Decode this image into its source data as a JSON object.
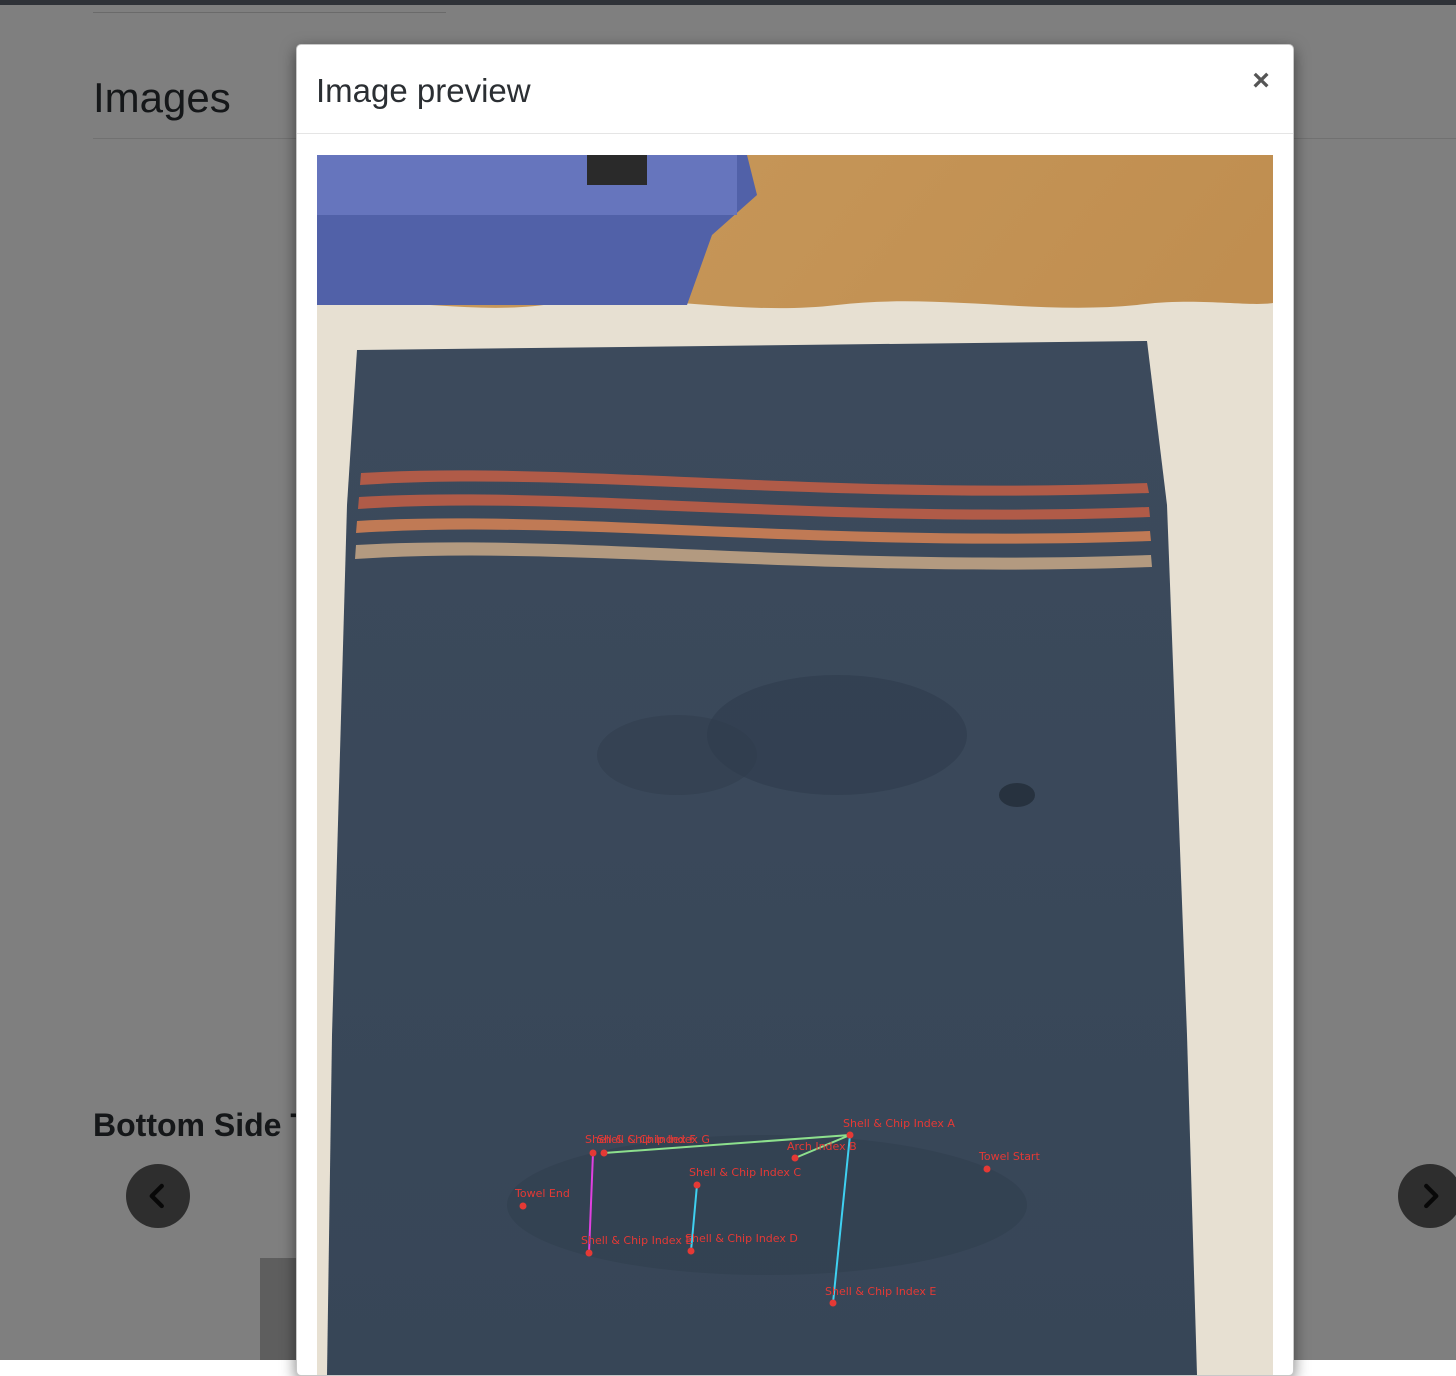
{
  "page": {
    "heading": "Images",
    "section_title": "Bottom Side T"
  },
  "carousel": {
    "prev_icon": "chevron-left-icon",
    "next_icon": "chevron-right-icon"
  },
  "modal": {
    "title": "Image preview",
    "close_label": "×"
  },
  "photo": {
    "annotations": [
      "Shell & Chip Index A",
      "Arch Index B",
      "Shell & Chip Index C",
      "Shell & Chip Index D",
      "Shell & Chip Index E",
      "Shell & Chip Index F",
      "Shell & Chip Index G",
      "Shell & Chip Index E",
      "Towel Start",
      "Towel End"
    ]
  },
  "colors": {
    "annotation": "#e53935",
    "line_green": "#8de08d",
    "line_cyan": "#3fd0f0",
    "line_magenta": "#e040e0"
  }
}
